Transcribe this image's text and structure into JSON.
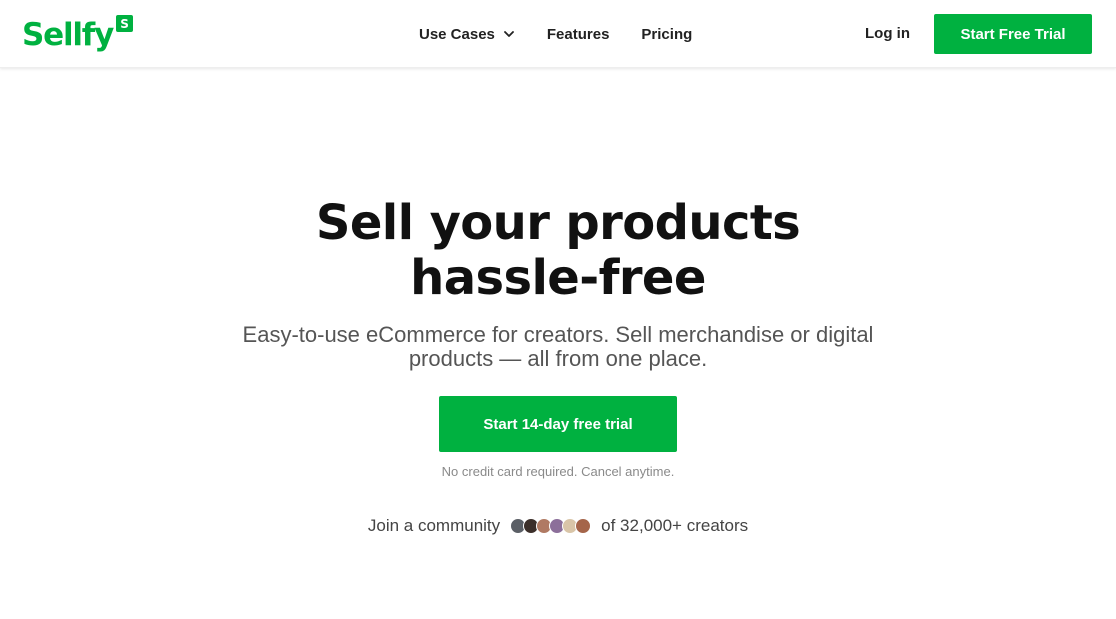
{
  "brand": {
    "name": "Sellfy",
    "badge": "S",
    "color": "#00b140"
  },
  "nav": {
    "items": [
      {
        "label": "Use Cases",
        "has_dropdown": true
      },
      {
        "label": "Features"
      },
      {
        "label": "Pricing"
      }
    ],
    "login_label": "Log in",
    "trial_label": "Start Free Trial"
  },
  "hero": {
    "title_line1": "Sell your products",
    "title_line2": "hassle-free",
    "subtitle_line1": "Easy-to-use eCommerce for creators. Sell merchandise or digital",
    "subtitle_line2": "products — all from one place.",
    "cta_label": "Start 14-day free trial",
    "note": "No credit card required. Cancel anytime.",
    "community_prefix": "Join a community",
    "community_suffix": "of 32,000+ creators",
    "avatar_colors": [
      "#5b5f66",
      "#3c2f2a",
      "#b07a63",
      "#8c6f9a",
      "#d9c5a8",
      "#a5654a"
    ]
  }
}
